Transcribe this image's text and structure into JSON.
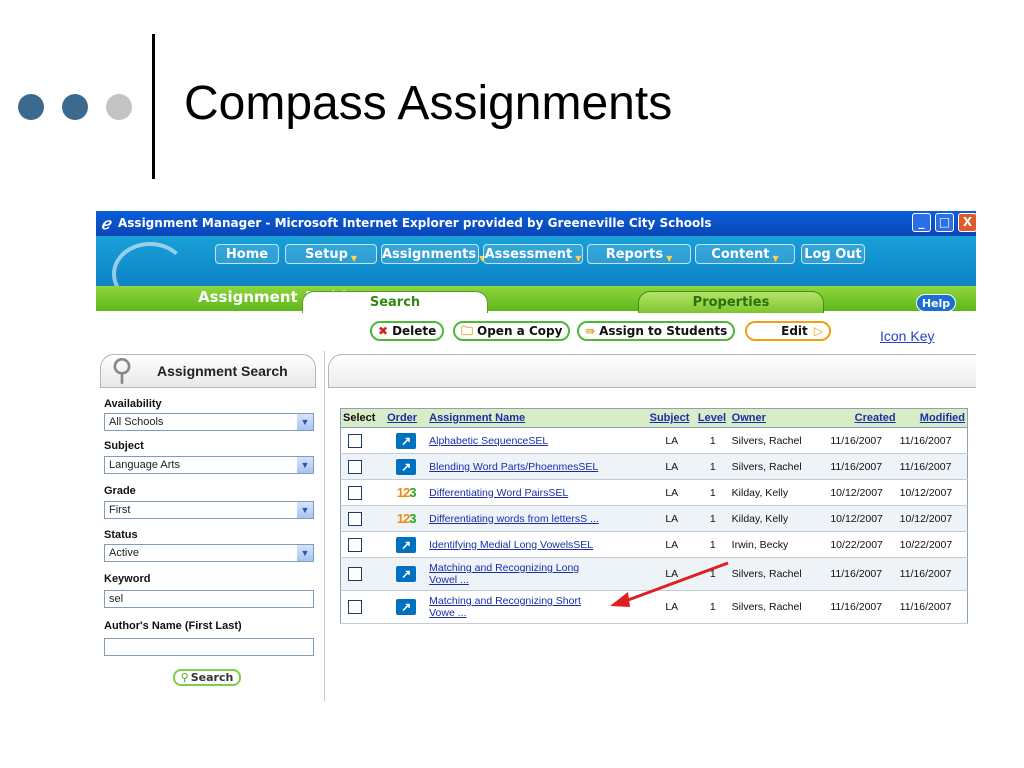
{
  "slide": {
    "title": "Compass Assignments"
  },
  "window": {
    "title": "Assignment Manager - Microsoft Internet Explorer provided by Greeneville City Schools",
    "buttons": {
      "minimize": "_",
      "maximize": "□",
      "close": "X"
    }
  },
  "nav": {
    "items": [
      {
        "label": "Home"
      },
      {
        "label": "Setup"
      },
      {
        "label": "Assignments"
      },
      {
        "label": "Assessment"
      },
      {
        "label": "Reports"
      },
      {
        "label": "Content"
      },
      {
        "label": "Log Out"
      }
    ]
  },
  "section": {
    "title": "Assignment Archive",
    "tabs": [
      {
        "label": "Search"
      },
      {
        "label": "Properties"
      }
    ],
    "help": "Help"
  },
  "toolbar": {
    "delete": "Delete",
    "open_copy": "Open a Copy",
    "assign": "Assign to Students",
    "edit": "Edit",
    "icon_key": "Icon Key"
  },
  "search_panel": {
    "title": "Assignment Search",
    "availability": {
      "label": "Availability",
      "value": "All Schools"
    },
    "subject": {
      "label": "Subject",
      "value": "Language Arts"
    },
    "grade": {
      "label": "Grade",
      "value": "First"
    },
    "status": {
      "label": "Status",
      "value": "Active"
    },
    "keyword": {
      "label": "Keyword",
      "value": "sel"
    },
    "author": {
      "label": "Author's Name (First Last)",
      "value": ""
    },
    "search_button": "Search"
  },
  "table": {
    "headers": {
      "select": "Select",
      "order": "Order",
      "name": "Assignment Name",
      "subject": "Subject",
      "level": "Level",
      "owner": "Owner",
      "created": "Created",
      "modified": "Modified"
    },
    "rows": [
      {
        "icon": "arrow-icon",
        "name": "Alphabetic SequenceSEL",
        "subject": "LA",
        "level": "1",
        "owner": "Silvers, Rachel",
        "created": "11/16/2007",
        "modified": "11/16/2007"
      },
      {
        "icon": "arrow-icon",
        "name": "Blending Word Parts/PhoenmesSEL",
        "subject": "LA",
        "level": "1",
        "owner": "Silvers, Rachel",
        "created": "11/16/2007",
        "modified": "11/16/2007"
      },
      {
        "icon": "123-icon",
        "name": "Differentiating Word PairsSEL",
        "subject": "LA",
        "level": "1",
        "owner": "Kilday, Kelly",
        "created": "10/12/2007",
        "modified": "10/12/2007"
      },
      {
        "icon": "123-icon",
        "name": "Differentiating words from lettersS ...",
        "subject": "LA",
        "level": "1",
        "owner": "Kilday, Kelly",
        "created": "10/12/2007",
        "modified": "10/12/2007"
      },
      {
        "icon": "arrow-icon",
        "name": "Identifying Medial Long VowelsSEL",
        "subject": "LA",
        "level": "1",
        "owner": "Irwin, Becky",
        "created": "10/22/2007",
        "modified": "10/22/2007"
      },
      {
        "icon": "arrow-icon",
        "name_line1": "Matching and Recognizing Long",
        "name_line2": "Vowel ...",
        "subject": "LA",
        "level": "1",
        "owner": "Silvers, Rachel",
        "created": "11/16/2007",
        "modified": "11/16/2007"
      },
      {
        "icon": "arrow-icon",
        "name_line1": "Matching and Recognizing Short",
        "name_line2": "Vowe ...",
        "subject": "LA",
        "level": "1",
        "owner": "Silvers, Rachel",
        "created": "11/16/2007",
        "modified": "11/16/2007"
      }
    ]
  },
  "colors": {
    "annotation_arrow": "#e02020",
    "titlebar": "#0b4fc4",
    "header_blue": "#0d86c8",
    "header_green": "#5cb71c",
    "link": "#1a2ea8"
  }
}
